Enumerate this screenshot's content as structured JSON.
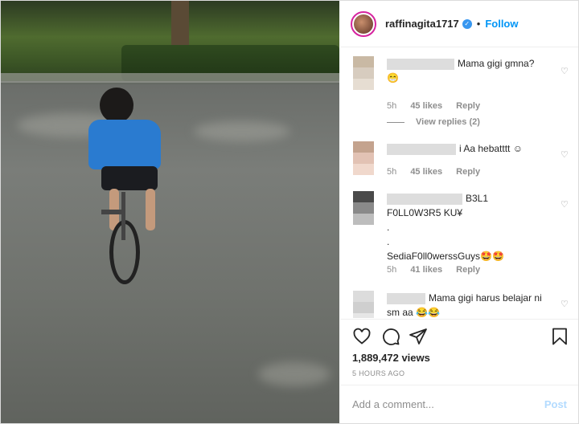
{
  "header": {
    "username": "raffinagita1717",
    "separator": "•",
    "follow_label": "Follow",
    "verified_glyph": "✓"
  },
  "comments": [
    {
      "text": "Mama gigi gmna?",
      "emoji": "😁",
      "time": "5h",
      "likes": "45 likes",
      "reply": "Reply",
      "avatar_colors": [
        "#c9b9a4",
        "#d7ccbf",
        "#e6ddd2"
      ]
    },
    {
      "text": "i Aa hebatttt ☺",
      "time": "5h",
      "likes": "45 likes",
      "reply": "Reply",
      "avatar_colors": [
        "#c4a38e",
        "#e2c2b4",
        "#f0d8cc"
      ]
    },
    {
      "text_line1": "B3L1",
      "text_line2": "F0LL0W3R5 KU¥",
      "text_line3": ".",
      "text_line4": ".",
      "text_line5": "SediaF0ll0werssGuys🤩🤩",
      "time": "5h",
      "likes": "41 likes",
      "reply": "Reply",
      "avatar_colors": [
        "#4a4a4a",
        "#8a8a8a",
        "#bdbdbd"
      ]
    },
    {
      "text": "Mama gigi harus belajar ni sm aa 😂😂",
      "avatar_colors": [
        "#dcdcdc",
        "#cfcfcf",
        "#e6e6e6"
      ]
    }
  ],
  "view_replies": "View replies (2)",
  "actions": {
    "like_icon": "heart-icon",
    "comment_icon": "comment-icon",
    "share_icon": "share-icon",
    "save_icon": "bookmark-icon"
  },
  "views": "1,889,472 views",
  "time_ago": "5 HOURS AGO",
  "add_comment": {
    "placeholder": "Add a comment...",
    "post_label": "Post"
  }
}
